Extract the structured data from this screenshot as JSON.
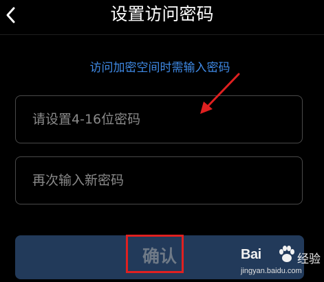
{
  "header": {
    "title": "设置访问密码",
    "back_icon": "chevron-left-icon"
  },
  "hint": "访问加密空间时需输入密码",
  "fields": {
    "password": {
      "placeholder": "请设置4-16位密码",
      "value": ""
    },
    "confirm_password": {
      "placeholder": "再次输入新密码",
      "value": ""
    }
  },
  "confirm_button": {
    "label": "确认"
  },
  "annotations": {
    "arrow_icon": "red-arrow-icon",
    "highlight_color": "#e02020"
  },
  "watermark": {
    "brand": "Bai",
    "brand_icon": "paw-icon",
    "sub": "经验",
    "url": "jingyan.baidu.com"
  },
  "colors": {
    "background": "#000000",
    "hint_text": "#3f8ae6",
    "button_bg": "#223a5a",
    "button_text": "#6f7a87",
    "field_border": "#4a4a4a",
    "placeholder": "#8a8a8a"
  }
}
